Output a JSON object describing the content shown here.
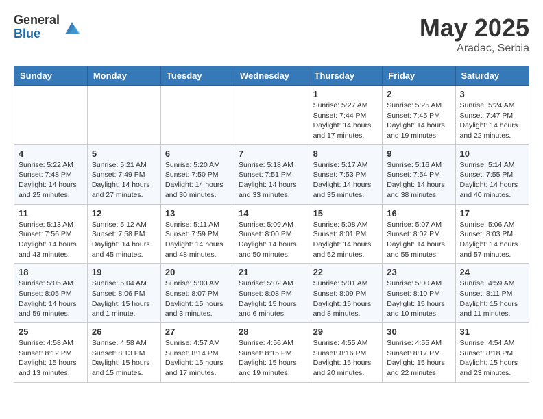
{
  "logo": {
    "general": "General",
    "blue": "Blue"
  },
  "title": {
    "month": "May 2025",
    "location": "Aradac, Serbia"
  },
  "weekdays": [
    "Sunday",
    "Monday",
    "Tuesday",
    "Wednesday",
    "Thursday",
    "Friday",
    "Saturday"
  ],
  "weeks": [
    [
      {
        "day": "",
        "info": ""
      },
      {
        "day": "",
        "info": ""
      },
      {
        "day": "",
        "info": ""
      },
      {
        "day": "",
        "info": ""
      },
      {
        "day": "1",
        "info": "Sunrise: 5:27 AM\nSunset: 7:44 PM\nDaylight: 14 hours\nand 17 minutes."
      },
      {
        "day": "2",
        "info": "Sunrise: 5:25 AM\nSunset: 7:45 PM\nDaylight: 14 hours\nand 19 minutes."
      },
      {
        "day": "3",
        "info": "Sunrise: 5:24 AM\nSunset: 7:47 PM\nDaylight: 14 hours\nand 22 minutes."
      }
    ],
    [
      {
        "day": "4",
        "info": "Sunrise: 5:22 AM\nSunset: 7:48 PM\nDaylight: 14 hours\nand 25 minutes."
      },
      {
        "day": "5",
        "info": "Sunrise: 5:21 AM\nSunset: 7:49 PM\nDaylight: 14 hours\nand 27 minutes."
      },
      {
        "day": "6",
        "info": "Sunrise: 5:20 AM\nSunset: 7:50 PM\nDaylight: 14 hours\nand 30 minutes."
      },
      {
        "day": "7",
        "info": "Sunrise: 5:18 AM\nSunset: 7:51 PM\nDaylight: 14 hours\nand 33 minutes."
      },
      {
        "day": "8",
        "info": "Sunrise: 5:17 AM\nSunset: 7:53 PM\nDaylight: 14 hours\nand 35 minutes."
      },
      {
        "day": "9",
        "info": "Sunrise: 5:16 AM\nSunset: 7:54 PM\nDaylight: 14 hours\nand 38 minutes."
      },
      {
        "day": "10",
        "info": "Sunrise: 5:14 AM\nSunset: 7:55 PM\nDaylight: 14 hours\nand 40 minutes."
      }
    ],
    [
      {
        "day": "11",
        "info": "Sunrise: 5:13 AM\nSunset: 7:56 PM\nDaylight: 14 hours\nand 43 minutes."
      },
      {
        "day": "12",
        "info": "Sunrise: 5:12 AM\nSunset: 7:58 PM\nDaylight: 14 hours\nand 45 minutes."
      },
      {
        "day": "13",
        "info": "Sunrise: 5:11 AM\nSunset: 7:59 PM\nDaylight: 14 hours\nand 48 minutes."
      },
      {
        "day": "14",
        "info": "Sunrise: 5:09 AM\nSunset: 8:00 PM\nDaylight: 14 hours\nand 50 minutes."
      },
      {
        "day": "15",
        "info": "Sunrise: 5:08 AM\nSunset: 8:01 PM\nDaylight: 14 hours\nand 52 minutes."
      },
      {
        "day": "16",
        "info": "Sunrise: 5:07 AM\nSunset: 8:02 PM\nDaylight: 14 hours\nand 55 minutes."
      },
      {
        "day": "17",
        "info": "Sunrise: 5:06 AM\nSunset: 8:03 PM\nDaylight: 14 hours\nand 57 minutes."
      }
    ],
    [
      {
        "day": "18",
        "info": "Sunrise: 5:05 AM\nSunset: 8:05 PM\nDaylight: 14 hours\nand 59 minutes."
      },
      {
        "day": "19",
        "info": "Sunrise: 5:04 AM\nSunset: 8:06 PM\nDaylight: 15 hours\nand 1 minute."
      },
      {
        "day": "20",
        "info": "Sunrise: 5:03 AM\nSunset: 8:07 PM\nDaylight: 15 hours\nand 3 minutes."
      },
      {
        "day": "21",
        "info": "Sunrise: 5:02 AM\nSunset: 8:08 PM\nDaylight: 15 hours\nand 6 minutes."
      },
      {
        "day": "22",
        "info": "Sunrise: 5:01 AM\nSunset: 8:09 PM\nDaylight: 15 hours\nand 8 minutes."
      },
      {
        "day": "23",
        "info": "Sunrise: 5:00 AM\nSunset: 8:10 PM\nDaylight: 15 hours\nand 10 minutes."
      },
      {
        "day": "24",
        "info": "Sunrise: 4:59 AM\nSunset: 8:11 PM\nDaylight: 15 hours\nand 11 minutes."
      }
    ],
    [
      {
        "day": "25",
        "info": "Sunrise: 4:58 AM\nSunset: 8:12 PM\nDaylight: 15 hours\nand 13 minutes."
      },
      {
        "day": "26",
        "info": "Sunrise: 4:58 AM\nSunset: 8:13 PM\nDaylight: 15 hours\nand 15 minutes."
      },
      {
        "day": "27",
        "info": "Sunrise: 4:57 AM\nSunset: 8:14 PM\nDaylight: 15 hours\nand 17 minutes."
      },
      {
        "day": "28",
        "info": "Sunrise: 4:56 AM\nSunset: 8:15 PM\nDaylight: 15 hours\nand 19 minutes."
      },
      {
        "day": "29",
        "info": "Sunrise: 4:55 AM\nSunset: 8:16 PM\nDaylight: 15 hours\nand 20 minutes."
      },
      {
        "day": "30",
        "info": "Sunrise: 4:55 AM\nSunset: 8:17 PM\nDaylight: 15 hours\nand 22 minutes."
      },
      {
        "day": "31",
        "info": "Sunrise: 4:54 AM\nSunset: 8:18 PM\nDaylight: 15 hours\nand 23 minutes."
      }
    ]
  ]
}
